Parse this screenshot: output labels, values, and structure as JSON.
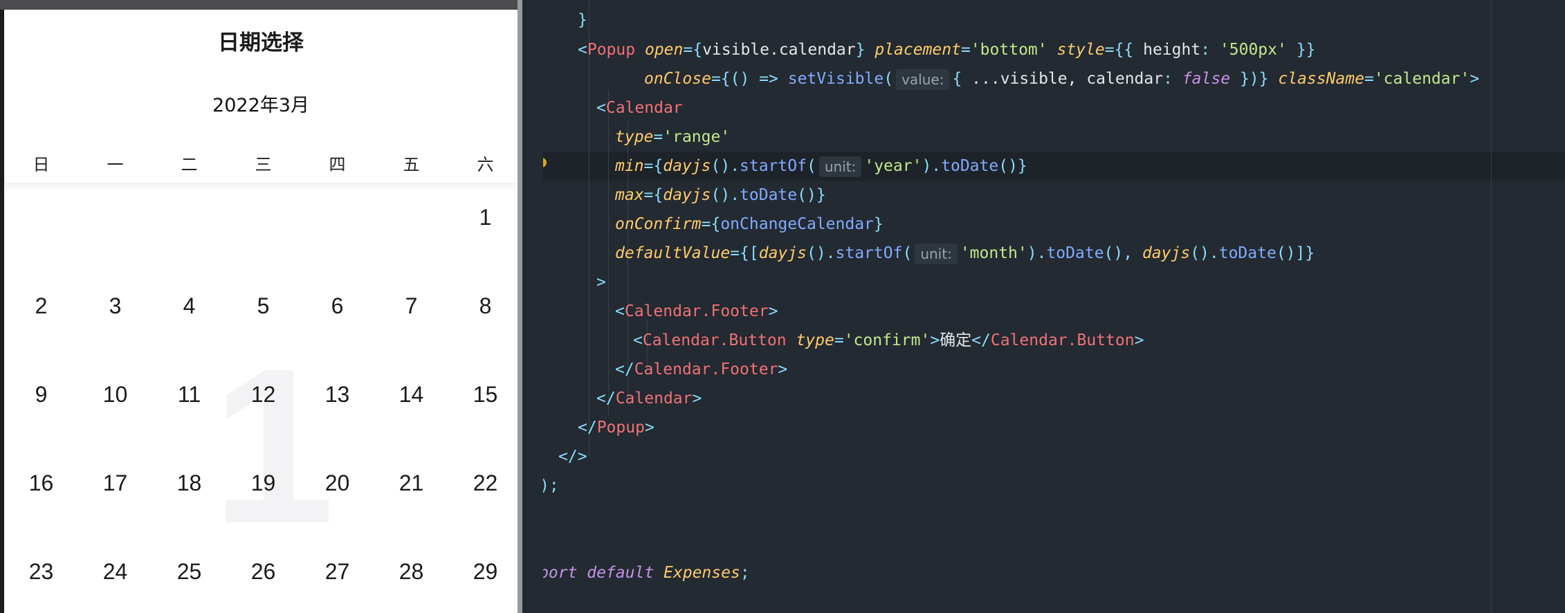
{
  "calendar": {
    "sheet_title": "日期选择",
    "month_title": "2022年3月",
    "weekdays": [
      "日",
      "一",
      "二",
      "三",
      "四",
      "五",
      "六"
    ],
    "watermark": "1",
    "days": [
      "1",
      "2",
      "3",
      "4",
      "5",
      "6",
      "7",
      "8",
      "9",
      "10",
      "11",
      "12",
      "13",
      "14",
      "15",
      "16",
      "17",
      "18",
      "19",
      "20",
      "21",
      "22",
      "23",
      "24",
      "25",
      "26",
      "27",
      "28",
      "29"
    ]
  },
  "editor": {
    "lines": [
      [
        [
          "t-p",
          "}"
        ]
      ],
      [
        [
          "t-p",
          "<"
        ],
        [
          "t-tag",
          "Popup"
        ],
        [
          "t-txt",
          " "
        ],
        [
          "t-attr",
          "open"
        ],
        [
          "t-p",
          "={"
        ],
        [
          "t-txt",
          "visible.calendar"
        ],
        [
          "t-p",
          "}"
        ],
        [
          "t-txt",
          " "
        ],
        [
          "t-attr",
          "placement"
        ],
        [
          "t-p",
          "="
        ],
        [
          "t-str",
          "'bottom'"
        ],
        [
          "t-txt",
          " "
        ],
        [
          "t-attr",
          "style"
        ],
        [
          "t-p",
          "={{"
        ],
        [
          "t-txt",
          " height"
        ],
        [
          "t-p",
          ":"
        ],
        [
          "t-txt",
          " "
        ],
        [
          "t-str",
          "'500px'"
        ],
        [
          "t-txt",
          " "
        ],
        [
          "t-p",
          "}}"
        ]
      ],
      [
        [
          "t-attr",
          "onClose"
        ],
        [
          "t-p",
          "={() =>"
        ],
        [
          "t-txt",
          " "
        ],
        [
          "t-fn",
          "setVisible"
        ],
        [
          "t-p",
          "("
        ],
        [
          "hint",
          "value:"
        ],
        [
          "t-p",
          "{"
        ],
        [
          "t-txt",
          " ...visible, calendar"
        ],
        [
          "t-p",
          ":"
        ],
        [
          "t-txt",
          " "
        ],
        [
          "t-kw",
          "false"
        ],
        [
          "t-txt",
          " "
        ],
        [
          "t-p",
          "})}"
        ],
        [
          "t-txt",
          " "
        ],
        [
          "t-attr",
          "className"
        ],
        [
          "t-p",
          "="
        ],
        [
          "t-str",
          "'calendar'"
        ],
        [
          "t-p",
          ">"
        ]
      ],
      [
        [
          "t-p",
          "<"
        ],
        [
          "t-tag",
          "Calendar"
        ]
      ],
      [
        [
          "t-attr",
          "type"
        ],
        [
          "t-p",
          "="
        ],
        [
          "t-str",
          "'range'"
        ]
      ],
      [
        [
          "t-attr",
          "min"
        ],
        [
          "t-p",
          "={"
        ],
        [
          "t-cls",
          "dayjs"
        ],
        [
          "t-p",
          "()."
        ],
        [
          "t-fn",
          "startOf"
        ],
        [
          "t-p",
          "("
        ],
        [
          "hint",
          "unit:"
        ],
        [
          "t-str",
          "'year'"
        ],
        [
          "t-p",
          ")."
        ],
        [
          "t-fn",
          "toDate"
        ],
        [
          "t-p",
          "()}"
        ]
      ],
      [
        [
          "t-attr",
          "max"
        ],
        [
          "t-p",
          "={"
        ],
        [
          "t-cls",
          "dayjs"
        ],
        [
          "t-p",
          "()."
        ],
        [
          "t-fn",
          "toDate"
        ],
        [
          "t-p",
          "()}"
        ]
      ],
      [
        [
          "t-attr",
          "onConfirm"
        ],
        [
          "t-p",
          "={"
        ],
        [
          "t-fn",
          "onChangeCalendar"
        ],
        [
          "t-p",
          "}"
        ]
      ],
      [
        [
          "t-attr",
          "defaultValue"
        ],
        [
          "t-p",
          "={["
        ],
        [
          "t-cls",
          "dayjs"
        ],
        [
          "t-p",
          "()."
        ],
        [
          "t-fn",
          "startOf"
        ],
        [
          "t-p",
          "("
        ],
        [
          "hint",
          "unit:"
        ],
        [
          "t-str",
          "'month'"
        ],
        [
          "t-p",
          ")."
        ],
        [
          "t-fn",
          "toDate"
        ],
        [
          "t-p",
          "(), "
        ],
        [
          "t-cls",
          "dayjs"
        ],
        [
          "t-p",
          "()."
        ],
        [
          "t-fn",
          "toDate"
        ],
        [
          "t-p",
          "()]}"
        ]
      ],
      [
        [
          "t-p",
          ">"
        ]
      ],
      [
        [
          "t-p",
          "<"
        ],
        [
          "t-tag",
          "Calendar.Footer"
        ],
        [
          "t-p",
          ">"
        ]
      ],
      [
        [
          "t-p",
          "<"
        ],
        [
          "t-tag",
          "Calendar.Button"
        ],
        [
          "t-txt",
          " "
        ],
        [
          "t-attr",
          "type"
        ],
        [
          "t-p",
          "="
        ],
        [
          "t-str",
          "'confirm'"
        ],
        [
          "t-p",
          ">"
        ],
        [
          "t-txt",
          "确定"
        ],
        [
          "t-p",
          "</"
        ],
        [
          "t-tag",
          "Calendar.Button"
        ],
        [
          "t-p",
          ">"
        ]
      ],
      [
        [
          "t-p",
          "</"
        ],
        [
          "t-tag",
          "Calendar.Footer"
        ],
        [
          "t-p",
          ">"
        ]
      ],
      [
        [
          "t-p",
          "</"
        ],
        [
          "t-tag",
          "Calendar"
        ],
        [
          "t-p",
          ">"
        ]
      ],
      [
        [
          "t-p",
          "</"
        ],
        [
          "t-tag",
          "Popup"
        ],
        [
          "t-p",
          ">"
        ]
      ],
      [
        [
          "t-p",
          "</>"
        ]
      ],
      [
        [
          "t-p",
          ");"
        ]
      ],
      [
        [
          "t-kw",
          "port default"
        ],
        [
          "t-txt",
          " "
        ],
        [
          "t-cls",
          "Expenses"
        ],
        [
          "t-p",
          ";"
        ]
      ]
    ]
  }
}
